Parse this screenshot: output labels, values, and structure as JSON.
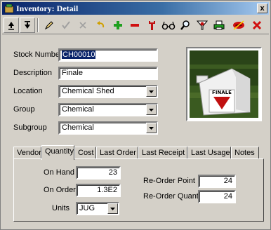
{
  "window": {
    "title": "Inventory: Detail",
    "close_label": "x"
  },
  "toolbar": {
    "buttons": [
      {
        "name": "first-record-icon"
      },
      {
        "name": "last-record-icon"
      },
      {
        "name": "edit-pencil-icon"
      },
      {
        "name": "save-check-icon"
      },
      {
        "name": "cancel-x-icon"
      },
      {
        "name": "undo-icon"
      },
      {
        "name": "add-plus-icon"
      },
      {
        "name": "delete-minus-icon"
      },
      {
        "name": "wrench-icon"
      },
      {
        "name": "glasses-icon"
      },
      {
        "name": "magnifier-icon"
      },
      {
        "name": "filter-funnel-icon"
      },
      {
        "name": "printer-icon"
      },
      {
        "name": "no-lips-icon"
      },
      {
        "name": "close-x-icon"
      }
    ]
  },
  "form": {
    "stock_number_label": "Stock Number",
    "stock_number_value": "CH00010",
    "description_label": "Description",
    "description_value": "Finale",
    "location_label": "Location",
    "location_value": "Chemical Shed",
    "group_label": "Group",
    "group_value": "Chemical",
    "subgroup_label": "Subgroup",
    "subgroup_value": "Chemical"
  },
  "image": {
    "product_label": "FINALE"
  },
  "tabs": [
    "Vendor",
    "Quantity",
    "Cost",
    "Last Order",
    "Last Receipt",
    "Last Usage",
    "Notes"
  ],
  "quantity": {
    "on_hand_label": "On Hand",
    "on_hand_value": "23",
    "on_order_label": "On Order",
    "on_order_value": "1.3E2",
    "units_label": "Units",
    "units_value": "JUG",
    "reorder_point_label": "Re-Order Point",
    "reorder_point_value": "24",
    "reorder_qty_label": "Re-Order Quantity",
    "reorder_qty_value": "24"
  },
  "colors": {
    "titlebar": "#0a246a",
    "face": "#d4d0c8",
    "selection": "#0a246a"
  }
}
